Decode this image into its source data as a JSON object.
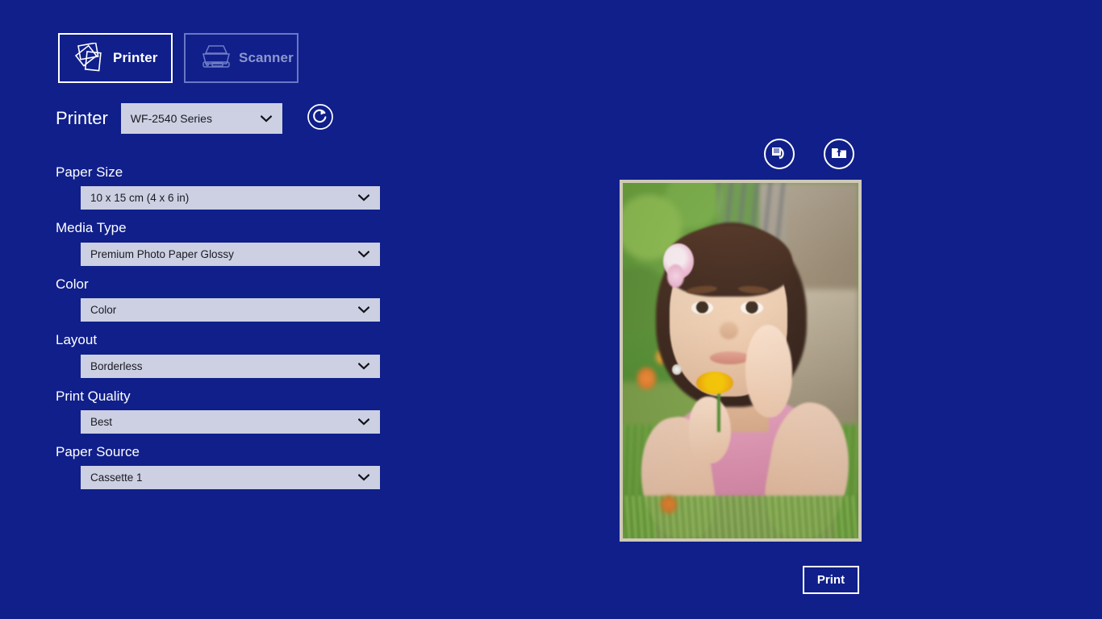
{
  "app": {
    "background_color": "#101f8a",
    "field_color": "#ccd0e2",
    "accent_color": "#ffffff",
    "inactive_color": "#8d97cf"
  },
  "device_tabs": [
    {
      "label": "Printer",
      "icon": "printer-pages-icon",
      "active": true
    },
    {
      "label": "Scanner",
      "icon": "scanner-flatbed-icon",
      "active": false
    }
  ],
  "printer_row": {
    "label": "Printer",
    "selected_printer": "WF-2540 Series",
    "refresh_icon": "refresh-circle-icon"
  },
  "settings": [
    {
      "label": "Paper Size",
      "value": "10 x 15 cm (4 x 6 in)"
    },
    {
      "label": "Media Type",
      "value": "Premium Photo Paper Glossy"
    },
    {
      "label": "Color",
      "value": "Color"
    },
    {
      "label": "Layout",
      "value": "Borderless"
    },
    {
      "label": "Print Quality",
      "value": "Best"
    },
    {
      "label": "Paper Source",
      "value": "Cassette 1"
    }
  ],
  "preview": {
    "toolbar": [
      {
        "icon": "rotate-image-icon",
        "name": "rotate-button"
      },
      {
        "icon": "open-folder-upload-icon",
        "name": "open-image-button"
      }
    ],
    "photo_description": "Young girl lying in grass holding a yellow flower, pink bow in hair, greenery and stone wall background"
  },
  "print_button": {
    "label": "Print"
  },
  "chevron_glyph": "⌄"
}
